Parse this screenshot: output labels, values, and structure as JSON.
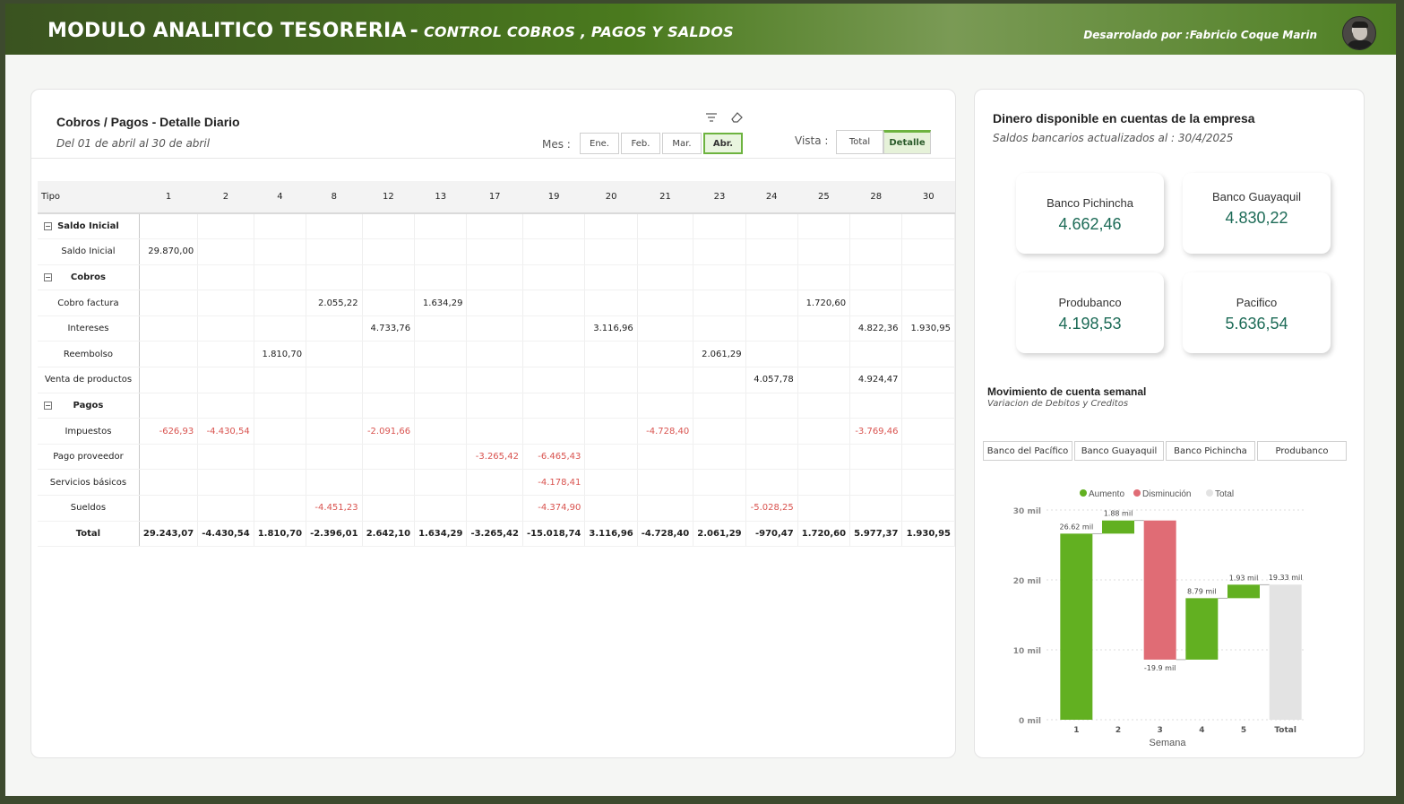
{
  "header": {
    "title": "MODULO ANALITICO TESORERIA",
    "dash": "-",
    "subtitle": "CONTROL COBROS , PAGOS Y SALDOS",
    "developer": "Desarrolado por :Fabricio Coque Marin"
  },
  "daily": {
    "title": "Cobros / Pagos - Detalle Diario",
    "subtitle": "Del 01 de abril al 30 de abril",
    "mes_label": "Mes :",
    "months": [
      "Ene.",
      "Feb.",
      "Mar.",
      "Abr."
    ],
    "selected_month": "Abr.",
    "vista_label": "Vista :",
    "vista_options": [
      "Total",
      "Detalle"
    ],
    "selected_vista": "Detalle",
    "columns": [
      "Tipo",
      "1",
      "2",
      "4",
      "8",
      "12",
      "13",
      "17",
      "19",
      "20",
      "21",
      "23",
      "24",
      "25",
      "28",
      "30"
    ],
    "rows": [
      {
        "kind": "group",
        "label": "Saldo Inicial",
        "cells": [
          "",
          "",
          "",
          "",
          "",
          "",
          "",
          "",
          "",
          "",
          "",
          "",
          "",
          "",
          ""
        ]
      },
      {
        "kind": "item",
        "label": "Saldo Inicial",
        "cells": [
          "29.870,00",
          "",
          "",
          "",
          "",
          "",
          "",
          "",
          "",
          "",
          "",
          "",
          "",
          "",
          ""
        ]
      },
      {
        "kind": "group",
        "label": "Cobros",
        "cells": [
          "",
          "",
          "",
          "",
          "",
          "",
          "",
          "",
          "",
          "",
          "",
          "",
          "",
          "",
          ""
        ]
      },
      {
        "kind": "item",
        "label": "Cobro factura",
        "cells": [
          "",
          "",
          "",
          "2.055,22",
          "",
          "1.634,29",
          "",
          "",
          "",
          "",
          "",
          "",
          "1.720,60",
          "",
          ""
        ]
      },
      {
        "kind": "item",
        "label": "Intereses",
        "cells": [
          "",
          "",
          "",
          "",
          "4.733,76",
          "",
          "",
          "",
          "3.116,96",
          "",
          "",
          "",
          "",
          "4.822,36",
          "1.930,95"
        ]
      },
      {
        "kind": "item",
        "label": "Reembolso",
        "cells": [
          "",
          "",
          "1.810,70",
          "",
          "",
          "",
          "",
          "",
          "",
          "",
          "2.061,29",
          "",
          "",
          "",
          ""
        ]
      },
      {
        "kind": "item",
        "label": "Venta de productos",
        "cells": [
          "",
          "",
          "",
          "",
          "",
          "",
          "",
          "",
          "",
          "",
          "",
          "4.057,78",
          "",
          "4.924,47",
          ""
        ]
      },
      {
        "kind": "group",
        "label": "Pagos",
        "cells": [
          "",
          "",
          "",
          "",
          "",
          "",
          "",
          "",
          "",
          "",
          "",
          "",
          "",
          "",
          ""
        ]
      },
      {
        "kind": "item",
        "label": "Impuestos",
        "cells": [
          "-626,93",
          "-4.430,54",
          "",
          "",
          "-2.091,66",
          "",
          "",
          "",
          "",
          "-4.728,40",
          "",
          "",
          "",
          "-3.769,46",
          ""
        ]
      },
      {
        "kind": "item",
        "label": "Pago proveedor",
        "cells": [
          "",
          "",
          "",
          "",
          "",
          "",
          "-3.265,42",
          "-6.465,43",
          "",
          "",
          "",
          "",
          "",
          "",
          ""
        ]
      },
      {
        "kind": "item",
        "label": "Servicios básicos",
        "cells": [
          "",
          "",
          "",
          "",
          "",
          "",
          "",
          "-4.178,41",
          "",
          "",
          "",
          "",
          "",
          "",
          ""
        ]
      },
      {
        "kind": "item",
        "label": "Sueldos",
        "cells": [
          "",
          "",
          "",
          "-4.451,23",
          "",
          "",
          "",
          "-4.374,90",
          "",
          "",
          "",
          "-5.028,25",
          "",
          "",
          ""
        ]
      },
      {
        "kind": "total",
        "label": "Total",
        "cells": [
          "29.243,07",
          "-4.430,54",
          "1.810,70",
          "-2.396,01",
          "2.642,10",
          "1.634,29",
          "-3.265,42",
          "-15.018,74",
          "3.116,96",
          "-4.728,40",
          "2.061,29",
          "-970,47",
          "1.720,60",
          "5.977,37",
          "1.930,95"
        ]
      }
    ]
  },
  "accounts": {
    "title": "Dinero disponible en cuentas de la empresa",
    "subtitle": "Saldos bancarios actualizados al : 30/4/2025",
    "kpis": [
      {
        "name": "Banco Pichincha",
        "value": "4.662,46"
      },
      {
        "name": "Banco Guayaquil",
        "value": "4.830,22"
      },
      {
        "name": "Produbanco",
        "value": "4.198,53"
      },
      {
        "name": "Pacifico",
        "value": "5.636,54"
      }
    ]
  },
  "weekly": {
    "title": "Movimiento de cuenta semanal",
    "subtitle": "Variacion de Debitos y Creditos",
    "banks": [
      "Banco del Pacífico",
      "Banco Guayaquil",
      "Banco Pichincha",
      "Produbanco"
    ]
  },
  "colors": {
    "increase": "#62b021",
    "decrease": "#e06c75",
    "total": "#e3e3e3",
    "accent": "#1d6b57"
  },
  "chart_data": {
    "type": "waterfall",
    "categories": [
      "1",
      "2",
      "3",
      "4",
      "5",
      "Total"
    ],
    "values": [
      26.62,
      1.88,
      -19.9,
      8.79,
      1.93,
      19.33
    ],
    "kinds": [
      "increase",
      "increase",
      "decrease",
      "increase",
      "increase",
      "total"
    ],
    "data_labels": [
      "26.62 mil",
      "1.88 mil",
      "-19.9 mil",
      "8.79 mil",
      "1.93 mil",
      "19.33 mil"
    ],
    "legend": [
      "Aumento",
      "Disminución",
      "Total"
    ],
    "legend_position": "top",
    "xlabel": "Semana",
    "ylabel": "",
    "yticks": [
      "0 mil",
      "10 mil",
      "20 mil",
      "30 mil"
    ],
    "ylim": [
      0,
      30
    ],
    "unit": "mil"
  }
}
